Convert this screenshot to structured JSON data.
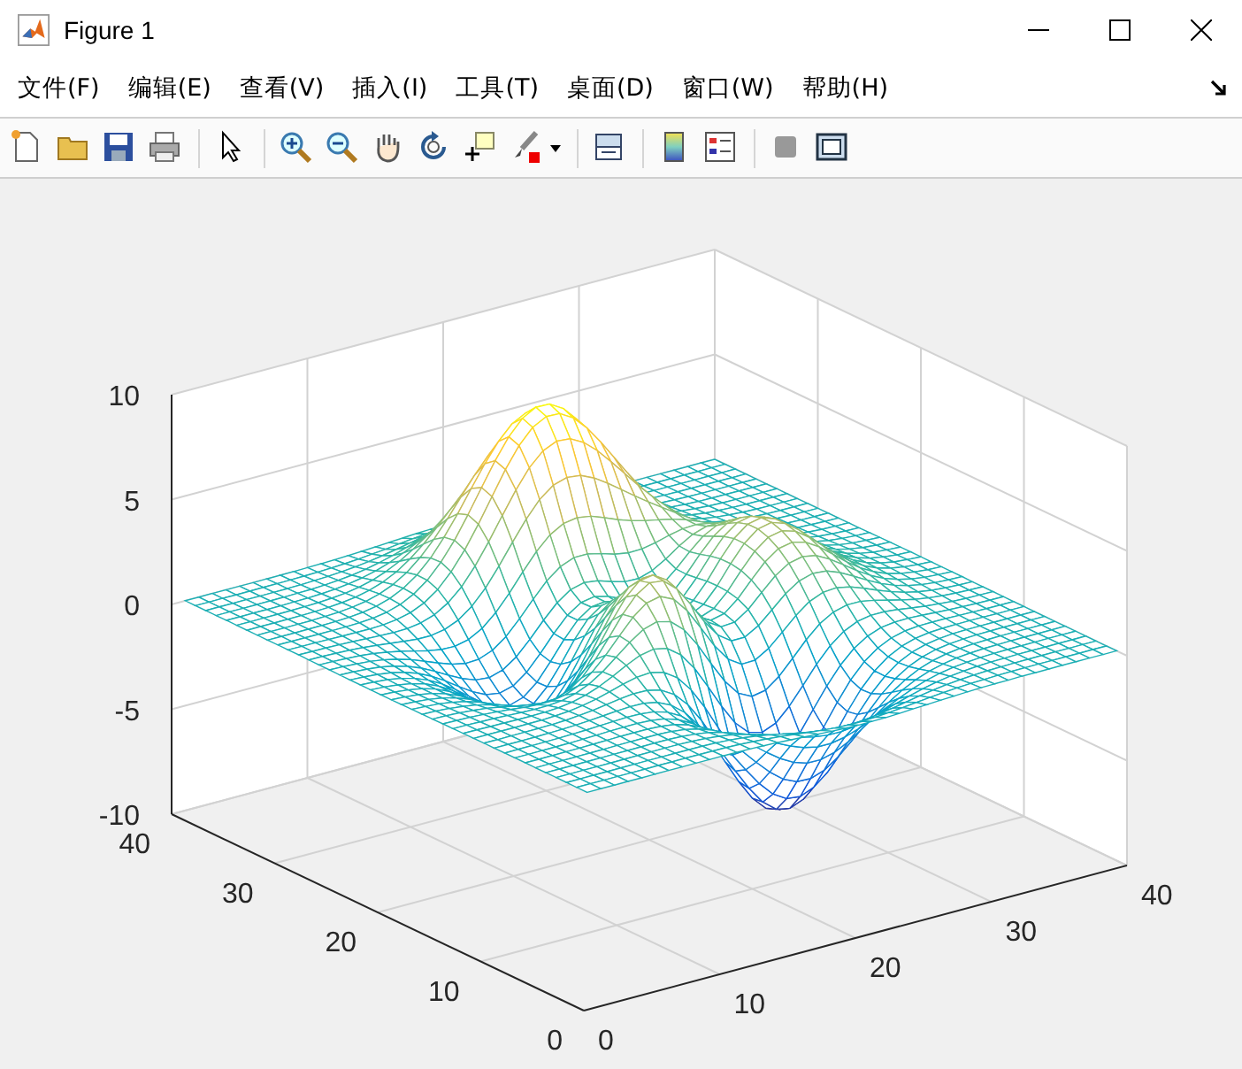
{
  "window": {
    "title": "Figure 1"
  },
  "menu": [
    "文件(F)",
    "编辑(E)",
    "查看(V)",
    "插入(I)",
    "工具(T)",
    "桌面(D)",
    "窗口(W)",
    "帮助(H)"
  ],
  "axes": {
    "z_ticks": [
      "10",
      "5",
      "0",
      "-5",
      "-10"
    ],
    "y_ticks": [
      "40",
      "30",
      "20",
      "10",
      "0"
    ],
    "x_ticks": [
      "0",
      "10",
      "20",
      "30",
      "40"
    ]
  }
}
